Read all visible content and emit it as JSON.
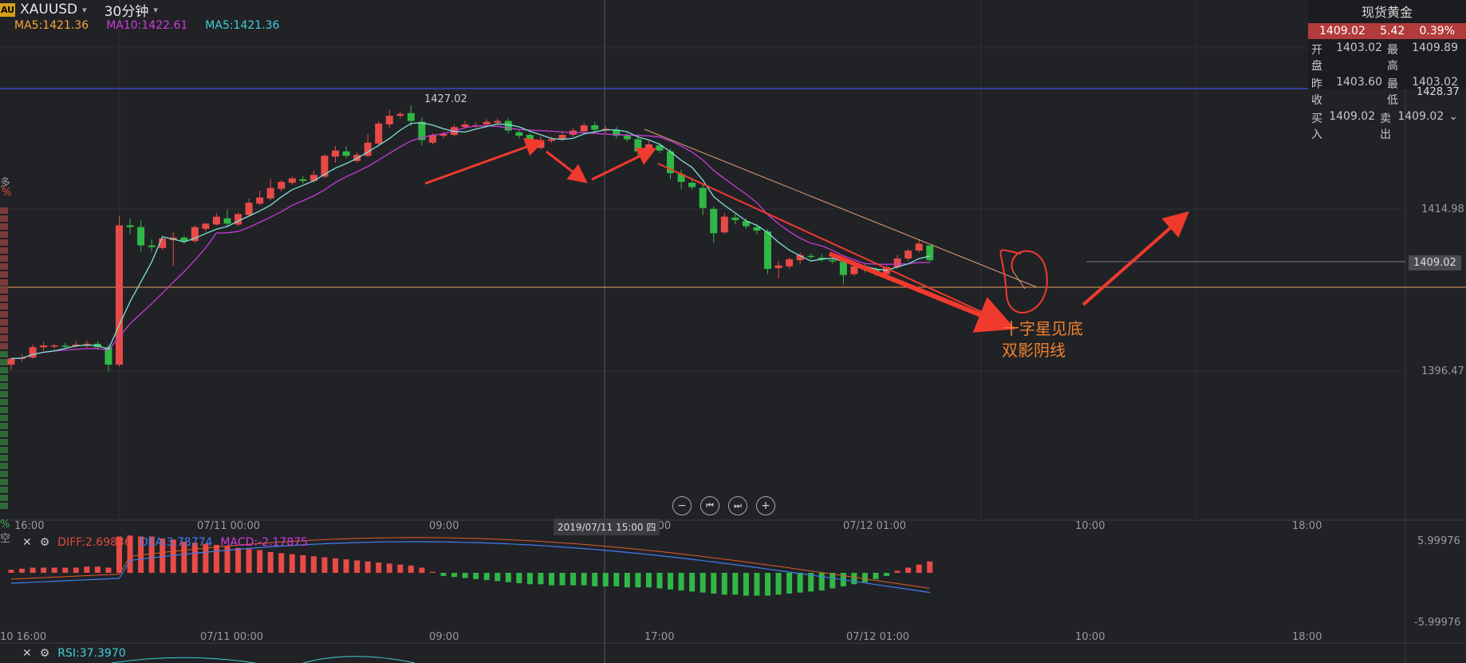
{
  "header": {
    "badge": "AU",
    "symbol": "XAUUSD",
    "period": "30分钟",
    "ma_labels": [
      {
        "text": "MA5:1421.36",
        "color": "#f7a53a"
      },
      {
        "text": "MA10:1422.61",
        "color": "#d03adf"
      },
      {
        "text": "MA5:1421.36",
        "color": "#3fcfd8"
      }
    ]
  },
  "quote_panel": {
    "title": "现货黄金",
    "price": "1409.02",
    "change": "5.42",
    "change_pct": "0.39%",
    "rows": [
      [
        "开盘",
        "1403.02",
        "最高",
        "1409.89"
      ],
      [
        "昨收",
        "1403.60",
        "最低",
        "1403.02"
      ],
      [
        "买入",
        "1409.02",
        "卖出",
        "1409.02"
      ]
    ]
  },
  "price_axis": {
    "labels": [
      "1428.37",
      "1414.98",
      "1409.02",
      "1396.47"
    ],
    "high_label": "1427.02",
    "left_labels": [
      "多",
      "%"
    ]
  },
  "time_axis": {
    "main": [
      "16:00",
      "07/11 00:00",
      "09:00",
      "7:00",
      "07/12 01:00",
      "10:00",
      "18:00"
    ],
    "cursor_tag": "2019/07/11 15:00 四",
    "macd": [
      "10 16:00",
      "07/11 00:00",
      "09:00",
      "17:00",
      "07/12 01:00",
      "10:00",
      "18:00"
    ],
    "left_pct": "%",
    "left_kong": "空"
  },
  "macd_panel": {
    "diff": "DIFF:2.69836",
    "dea": "DEA:3.78774",
    "macd": "MACD:-2.17875",
    "axis_top": "5.99976",
    "axis_bottom": "-5.99976"
  },
  "rsi_panel": {
    "label": "RSI:37.3970"
  },
  "controls": [
    "−",
    "⏮",
    "⏭",
    "+"
  ],
  "annotations": [
    "十字星见底",
    "双影阴线"
  ],
  "chart_data": {
    "type": "candlestick",
    "symbol": "XAUUSD",
    "interval": "30分钟",
    "ylim": [
      1392,
      1431
    ],
    "candles": [
      [
        1397.2,
        1398.0,
        1396.6,
        1397.9
      ],
      [
        1397.9,
        1398.4,
        1397.5,
        1398.0
      ],
      [
        1398.0,
        1399.5,
        1397.9,
        1399.2
      ],
      [
        1399.2,
        1399.8,
        1398.8,
        1399.4
      ],
      [
        1399.3,
        1399.6,
        1399.0,
        1399.4
      ],
      [
        1399.4,
        1399.7,
        1399.1,
        1399.3
      ],
      [
        1399.3,
        1399.9,
        1399.1,
        1399.5
      ],
      [
        1399.5,
        1400.0,
        1399.0,
        1399.6
      ],
      [
        1399.6,
        1399.9,
        1398.9,
        1399.2
      ],
      [
        1399.2,
        1399.5,
        1396.4,
        1397.2
      ],
      [
        1397.2,
        1414.3,
        1397.0,
        1413.2
      ],
      [
        1413.2,
        1414.0,
        1412.2,
        1413.0
      ],
      [
        1413.0,
        1413.8,
        1410.2,
        1410.9
      ],
      [
        1410.9,
        1411.6,
        1410.2,
        1410.7
      ],
      [
        1410.6,
        1412.0,
        1410.4,
        1411.7
      ],
      [
        1411.5,
        1412.4,
        1408.5,
        1411.8
      ],
      [
        1411.8,
        1412.0,
        1411.1,
        1411.4
      ],
      [
        1411.4,
        1413.2,
        1411.2,
        1413.0
      ],
      [
        1412.8,
        1413.5,
        1412.5,
        1413.4
      ],
      [
        1413.3,
        1414.6,
        1413.2,
        1414.2
      ],
      [
        1414.0,
        1415.0,
        1413.0,
        1413.4
      ],
      [
        1413.3,
        1414.7,
        1413.1,
        1414.5
      ],
      [
        1414.4,
        1416.3,
        1414.2,
        1415.8
      ],
      [
        1415.7,
        1417.2,
        1415.5,
        1416.4
      ],
      [
        1416.3,
        1418.5,
        1416.1,
        1417.5
      ],
      [
        1417.4,
        1418.4,
        1417.1,
        1418.2
      ],
      [
        1418.1,
        1418.8,
        1417.9,
        1418.6
      ],
      [
        1418.5,
        1418.9,
        1418.0,
        1418.3
      ],
      [
        1418.3,
        1419.5,
        1418.1,
        1419.0
      ],
      [
        1418.8,
        1421.4,
        1418.6,
        1421.2
      ],
      [
        1421.1,
        1422.3,
        1420.4,
        1421.8
      ],
      [
        1421.7,
        1422.3,
        1420.9,
        1421.2
      ],
      [
        1420.6,
        1421.6,
        1420.4,
        1421.3
      ],
      [
        1421.2,
        1423.7,
        1421.0,
        1422.7
      ],
      [
        1422.6,
        1425.2,
        1422.4,
        1424.9
      ],
      [
        1424.8,
        1426.5,
        1424.4,
        1425.8
      ],
      [
        1425.8,
        1426.3,
        1425.5,
        1426.0
      ],
      [
        1426.1,
        1427.0,
        1424.6,
        1425.2
      ],
      [
        1425.1,
        1425.6,
        1422.4,
        1423.0
      ],
      [
        1422.7,
        1423.8,
        1422.5,
        1423.6
      ],
      [
        1423.5,
        1424.0,
        1423.2,
        1423.7
      ],
      [
        1423.6,
        1424.8,
        1423.4,
        1424.5
      ],
      [
        1424.5,
        1425.2,
        1424.3,
        1424.8
      ],
      [
        1424.6,
        1425.0,
        1424.4,
        1424.7
      ],
      [
        1424.8,
        1425.4,
        1424.6,
        1425.1
      ],
      [
        1425.0,
        1425.5,
        1424.7,
        1425.2
      ],
      [
        1425.2,
        1425.5,
        1423.8,
        1424.1
      ],
      [
        1423.9,
        1424.2,
        1423.2,
        1423.5
      ],
      [
        1423.6,
        1423.8,
        1421.8,
        1422.2
      ],
      [
        1422.1,
        1423.4,
        1421.9,
        1423.0
      ],
      [
        1422.9,
        1423.4,
        1422.7,
        1423.1
      ],
      [
        1423.1,
        1423.9,
        1422.9,
        1423.6
      ],
      [
        1423.6,
        1424.4,
        1423.4,
        1424.1
      ],
      [
        1424.0,
        1425.0,
        1423.8,
        1424.7
      ],
      [
        1424.7,
        1425.1,
        1424.0,
        1424.2
      ],
      [
        1424.1,
        1424.6,
        1423.8,
        1424.3
      ],
      [
        1424.2,
        1424.5,
        1423.2,
        1423.5
      ],
      [
        1423.5,
        1423.8,
        1422.8,
        1423.1
      ],
      [
        1423.1,
        1423.7,
        1421.2,
        1421.7
      ],
      [
        1421.8,
        1422.9,
        1421.6,
        1422.5
      ],
      [
        1422.4,
        1422.7,
        1421.5,
        1421.8
      ],
      [
        1421.7,
        1422.0,
        1418.5,
        1419.2
      ],
      [
        1419.1,
        1419.6,
        1417.4,
        1418.2
      ],
      [
        1418.1,
        1418.5,
        1417.3,
        1417.6
      ],
      [
        1417.5,
        1418.0,
        1414.4,
        1415.2
      ],
      [
        1415.1,
        1415.4,
        1411.2,
        1412.3
      ],
      [
        1412.4,
        1414.6,
        1412.2,
        1414.2
      ],
      [
        1414.1,
        1414.5,
        1413.3,
        1413.8
      ],
      [
        1413.7,
        1414.0,
        1412.8,
        1413.1
      ],
      [
        1413.0,
        1413.3,
        1412.2,
        1412.6
      ],
      [
        1412.5,
        1412.8,
        1407.6,
        1408.2
      ],
      [
        1408.3,
        1409.1,
        1407.1,
        1408.6
      ],
      [
        1408.5,
        1409.5,
        1408.2,
        1409.3
      ],
      [
        1409.2,
        1410.1,
        1408.8,
        1409.8
      ],
      [
        1409.7,
        1410.0,
        1409.3,
        1409.6
      ],
      [
        1409.5,
        1409.9,
        1409.0,
        1409.3
      ],
      [
        1409.2,
        1409.5,
        1408.8,
        1409.1
      ],
      [
        1409.0,
        1409.3,
        1406.4,
        1407.5
      ],
      [
        1407.6,
        1408.7,
        1407.4,
        1408.5
      ],
      [
        1408.5,
        1408.8,
        1407.8,
        1408.1
      ],
      [
        1408.1,
        1408.4,
        1407.4,
        1407.7
      ],
      [
        1407.6,
        1408.6,
        1407.5,
        1408.4
      ],
      [
        1408.4,
        1409.8,
        1408.2,
        1409.4
      ],
      [
        1409.4,
        1410.5,
        1409.1,
        1410.3
      ],
      [
        1410.3,
        1411.6,
        1410.1,
        1411.1
      ],
      [
        1410.9,
        1409.3,
        1409.0,
        1409.2
      ]
    ],
    "macd_hist": [
      0.3,
      0.4,
      0.5,
      0.5,
      0.5,
      0.5,
      0.5,
      0.6,
      0.6,
      0.5,
      3.5,
      3.6,
      3.5,
      3.5,
      3.3,
      3.2,
      3.0,
      2.9,
      2.8,
      2.7,
      2.6,
      2.4,
      2.3,
      2.2,
      2.0,
      1.9,
      1.8,
      1.7,
      1.6,
      1.5,
      1.4,
      1.3,
      1.2,
      1.1,
      1.0,
      0.9,
      0.8,
      0.7,
      0.5,
      0.1,
      -0.3,
      -0.4,
      -0.5,
      -0.6,
      -0.7,
      -0.8,
      -0.9,
      -1.0,
      -1.1,
      -1.1,
      -1.2,
      -1.2,
      -1.2,
      -1.2,
      -1.3,
      -1.3,
      -1.3,
      -1.4,
      -1.4,
      -1.4,
      -1.5,
      -1.6,
      -1.7,
      -1.8,
      -1.9,
      -2.0,
      -2.1,
      -2.1,
      -2.2,
      -2.2,
      -2.2,
      -2.1,
      -2.0,
      -1.9,
      -1.8,
      -1.7,
      -1.5,
      -1.3,
      -1.1,
      -0.9,
      -0.6,
      -0.3,
      0.2,
      0.5,
      0.8,
      1.1
    ]
  }
}
